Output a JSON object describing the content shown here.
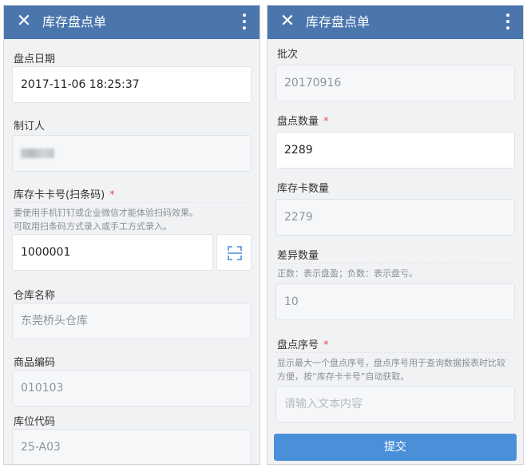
{
  "left": {
    "header": {
      "title": "库存盘点单"
    },
    "fields": {
      "date": {
        "label": "盘点日期",
        "value": "2017-11-06 18:25:37"
      },
      "maker": {
        "label": "制订人"
      },
      "card_no": {
        "label": "库存卡卡号(扫条码)",
        "required": "*",
        "hint1": "要使用手机钉钉或企业微信才能体验扫码效果。",
        "hint2": "可取用扫条码方式录入或手工方式录入。",
        "value": "1000001"
      },
      "warehouse": {
        "label": "仓库名称",
        "value": "东莞桥头仓库"
      },
      "product_code": {
        "label": "商品编码",
        "value": "010103"
      },
      "location_code": {
        "label": "库位代码",
        "value": "25-A03"
      }
    }
  },
  "right": {
    "header": {
      "title": "库存盘点单"
    },
    "fields": {
      "batch": {
        "label": "批次",
        "value": "20170916"
      },
      "count_qty": {
        "label": "盘点数量",
        "required": "*",
        "value": "2289"
      },
      "card_qty": {
        "label": "库存卡数量",
        "value": "2279"
      },
      "diff_qty": {
        "label": "差异数量",
        "hint": "正数：表示盘盈；负数：表示盘亏。",
        "value": "10"
      },
      "seq_no": {
        "label": "盘点序号",
        "required": "*",
        "hint1": "显示最大一个盘点序号，盘点序号用于查询数据报表时比较",
        "hint2": "方便，按“库存卡卡号”自动获取。",
        "placeholder": "请输入文本内容"
      }
    },
    "submit_label": "提交"
  },
  "colors": {
    "header": "#4a76ad",
    "submit": "#4a90d9",
    "required": "#e0534a"
  },
  "icons": [
    "close-icon",
    "more-vertical-icon",
    "scan-icon"
  ]
}
